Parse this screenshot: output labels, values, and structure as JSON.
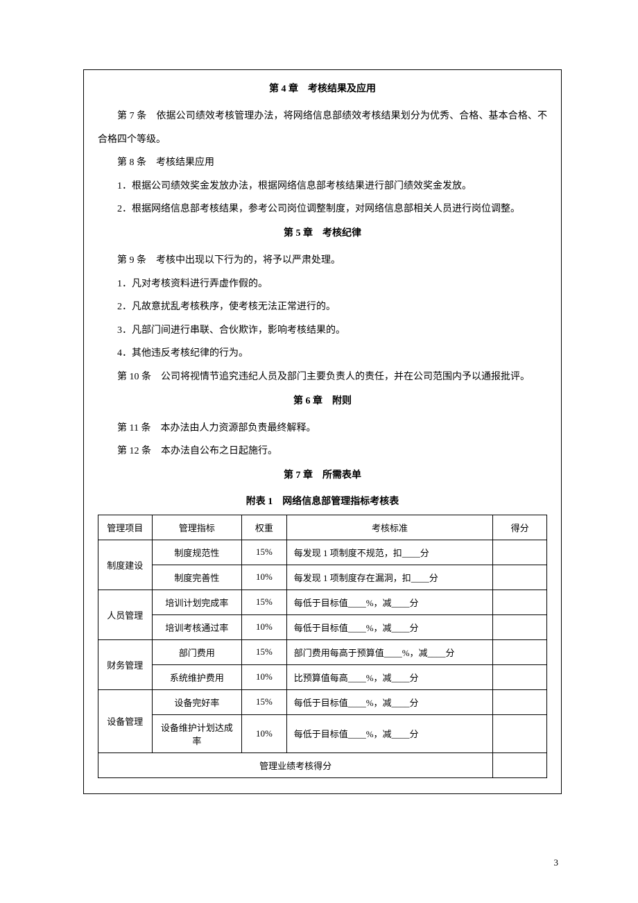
{
  "chapter4": {
    "title": "第 4 章　考核结果及应用",
    "a7": "第 7 条　依据公司绩效考核管理办法，将网络信息部绩效考核结果划分为优秀、合格、基本合格、不合格四个等级。",
    "a8": "第 8 条　考核结果应用",
    "a8_1": "1．根据公司绩效奖金发放办法，根据网络信息部考核结果进行部门绩效奖金发放。",
    "a8_2": "2．根据网络信息部考核结果，参考公司岗位调整制度，对网络信息部相关人员进行岗位调整。"
  },
  "chapter5": {
    "title": "第 5 章　考核纪律",
    "a9": "第 9 条　考核中出现以下行为的，将予以严肃处理。",
    "a9_1": "1．凡对考核资料进行弄虚作假的。",
    "a9_2": "2．凡故意扰乱考核秩序，使考核无法正常进行的。",
    "a9_3": "3．凡部门间进行串联、合伙欺诈，影响考核结果的。",
    "a9_4": "4．其他违反考核纪律的行为。",
    "a10": "第 10 条　公司将视情节追究违纪人员及部门主要负责人的责任，并在公司范围内予以通报批评。"
  },
  "chapter6": {
    "title": "第 6 章　附则",
    "a11": "第 11 条　本办法由人力资源部负责最终解释。",
    "a12": "第 12 条　本办法自公布之日起施行。"
  },
  "chapter7": {
    "title": "第 7 章　所需表单",
    "attach_title": "附表 1　网络信息部管理指标考核表"
  },
  "table": {
    "headers": {
      "item": "管理项目",
      "metric": "管理指标",
      "weight": "权重",
      "standard": "考核标准",
      "score": "得分"
    },
    "groups": [
      {
        "item": "制度建设",
        "rows": [
          {
            "metric": "制度规范性",
            "weight": "15%",
            "standard": "每发现 1 项制度不规范，扣____分",
            "score": ""
          },
          {
            "metric": "制度完善性",
            "weight": "10%",
            "standard": "每发现 1 项制度存在漏洞，扣____分",
            "score": ""
          }
        ]
      },
      {
        "item": "人员管理",
        "rows": [
          {
            "metric": "培训计划完成率",
            "weight": "15%",
            "standard": "每低于目标值____%，减____分",
            "score": ""
          },
          {
            "metric": "培训考核通过率",
            "weight": "10%",
            "standard": "每低于目标值____%，减____分",
            "score": ""
          }
        ]
      },
      {
        "item": "财务管理",
        "rows": [
          {
            "metric": "部门费用",
            "weight": "15%",
            "standard": "部门费用每高于预算值____%，减____分",
            "score": ""
          },
          {
            "metric": "系统维护费用",
            "weight": "10%",
            "standard": "比预算值每高____%，减____分",
            "score": ""
          }
        ]
      },
      {
        "item": "设备管理",
        "rows": [
          {
            "metric": "设备完好率",
            "weight": "15%",
            "standard": "每低于目标值____%，减____分",
            "score": ""
          },
          {
            "metric": "设备维护计划达成率",
            "weight": "10%",
            "standard": "每低于目标值____%，减____分",
            "score": ""
          }
        ]
      }
    ],
    "footer_label": "管理业绩考核得分",
    "footer_value": ""
  },
  "page_number": "3"
}
